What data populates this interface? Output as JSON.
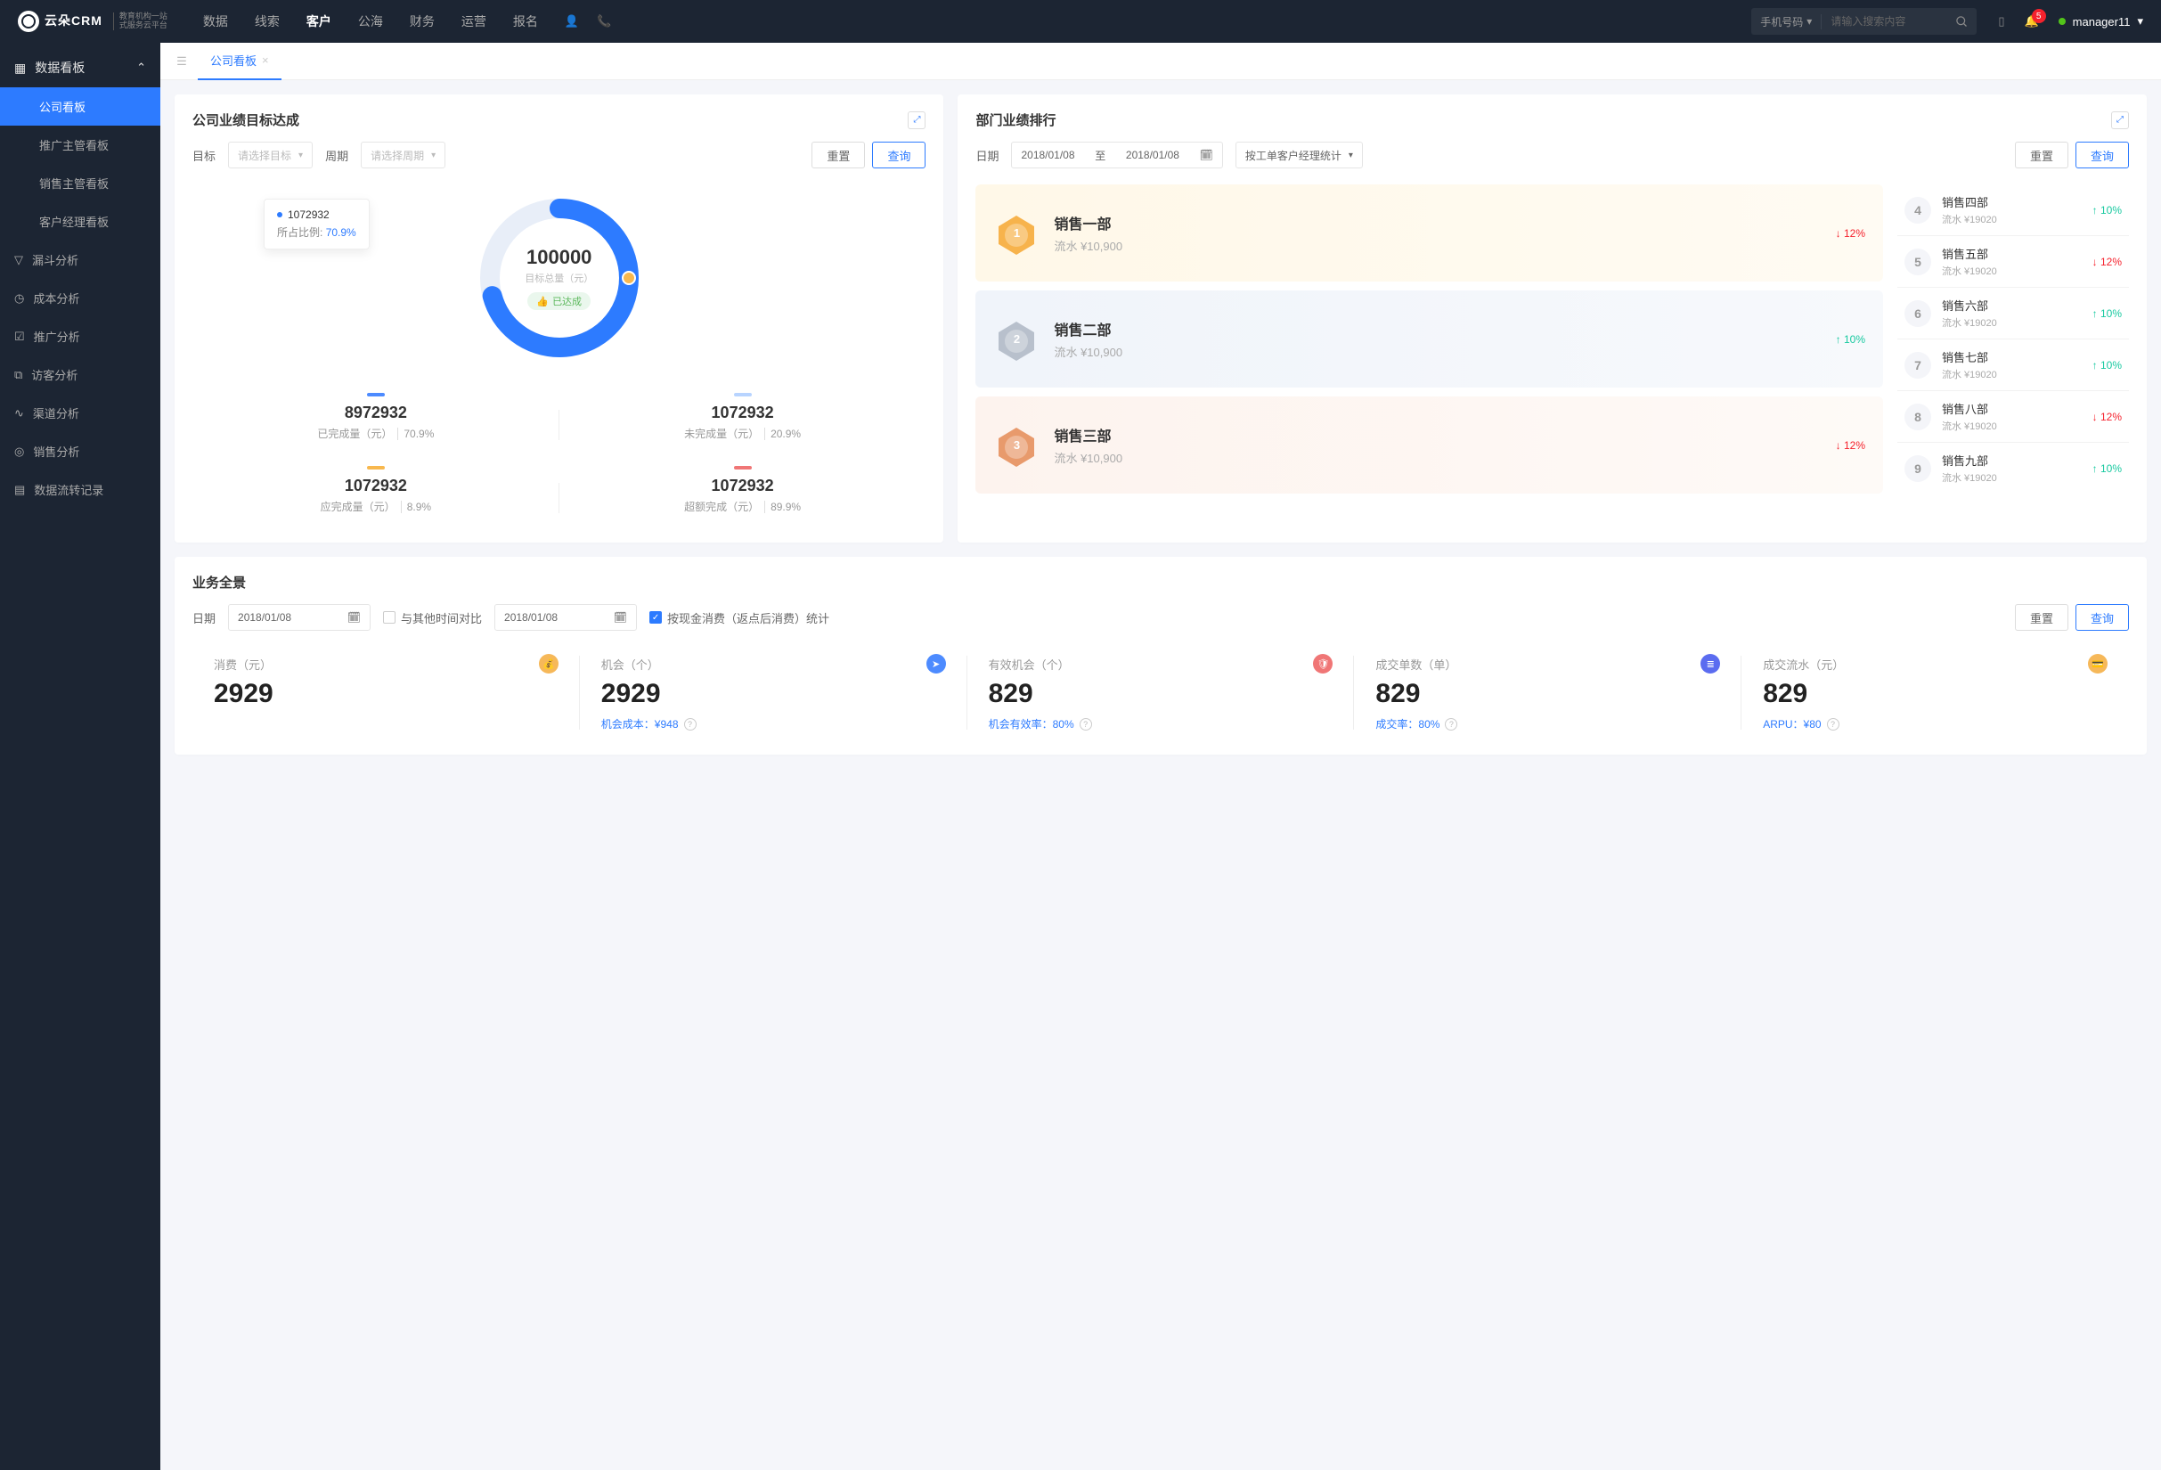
{
  "brand": {
    "name": "云朵CRM",
    "sub1": "教育机构一站",
    "sub2": "式服务云平台"
  },
  "nav": {
    "items": [
      "数据",
      "线索",
      "客户",
      "公海",
      "财务",
      "运营",
      "报名"
    ],
    "active": 2
  },
  "search": {
    "type": "手机号码",
    "placeholder": "请输入搜索内容"
  },
  "notif": {
    "count": "5"
  },
  "user": {
    "name": "manager11"
  },
  "sidebar": {
    "group": "数据看板",
    "items": [
      "公司看板",
      "推广主管看板",
      "销售主管看板",
      "客户经理看板"
    ],
    "active": 0,
    "cats": [
      "漏斗分析",
      "成本分析",
      "推广分析",
      "访客分析",
      "渠道分析",
      "销售分析",
      "数据流转记录"
    ]
  },
  "tab": {
    "name": "公司看板"
  },
  "goal": {
    "title": "公司业绩目标达成",
    "labels": {
      "target": "目标",
      "period": "周期"
    },
    "placeholders": {
      "target": "请选择目标",
      "period": "请选择周期"
    },
    "buttons": {
      "reset": "重置",
      "query": "查询"
    },
    "tooltip": {
      "value": "1072932",
      "ratioLabel": "所占比例:",
      "ratio": "70.9%"
    },
    "center": {
      "value": "100000",
      "sub": "目标总量（元）",
      "badge": "已达成"
    },
    "stats": [
      {
        "bar": "#4d8bff",
        "value": "8972932",
        "label": "已完成量（元）",
        "pct": "70.9%"
      },
      {
        "bar": "#b8d4ff",
        "value": "1072932",
        "label": "未完成量（元）",
        "pct": "20.9%"
      },
      {
        "bar": "#f8b84e",
        "value": "1072932",
        "label": "应完成量（元）",
        "pct": "8.9%"
      },
      {
        "bar": "#f07676",
        "value": "1072932",
        "label": "超额完成（元）",
        "pct": "89.9%"
      }
    ]
  },
  "rank": {
    "title": "部门业绩排行",
    "labels": {
      "date": "日期",
      "to": "至"
    },
    "date1": "2018/01/08",
    "date2": "2018/01/08",
    "grouping": "按工单客户经理统计",
    "buttons": {
      "reset": "重置",
      "query": "查询"
    },
    "top": [
      {
        "n": "1",
        "name": "销售一部",
        "amt": "流水 ¥10,900",
        "pct": "12%",
        "dir": "down"
      },
      {
        "n": "2",
        "name": "销售二部",
        "amt": "流水 ¥10,900",
        "pct": "10%",
        "dir": "up"
      },
      {
        "n": "3",
        "name": "销售三部",
        "amt": "流水 ¥10,900",
        "pct": "12%",
        "dir": "down"
      }
    ],
    "list": [
      {
        "n": "4",
        "name": "销售四部",
        "amt": "流水 ¥19020",
        "pct": "10%",
        "dir": "up"
      },
      {
        "n": "5",
        "name": "销售五部",
        "amt": "流水 ¥19020",
        "pct": "12%",
        "dir": "down"
      },
      {
        "n": "6",
        "name": "销售六部",
        "amt": "流水 ¥19020",
        "pct": "10%",
        "dir": "up"
      },
      {
        "n": "7",
        "name": "销售七部",
        "amt": "流水 ¥19020",
        "pct": "10%",
        "dir": "up"
      },
      {
        "n": "8",
        "name": "销售八部",
        "amt": "流水 ¥19020",
        "pct": "12%",
        "dir": "down"
      },
      {
        "n": "9",
        "name": "销售九部",
        "amt": "流水 ¥19020",
        "pct": "10%",
        "dir": "up"
      }
    ]
  },
  "overview": {
    "title": "业务全景",
    "labels": {
      "date": "日期",
      "compare": "与其他时间对比",
      "checkbox": "按现金消费（返点后消费）统计"
    },
    "date1": "2018/01/08",
    "date2": "2018/01/08",
    "buttons": {
      "reset": "重置",
      "query": "查询"
    },
    "kpis": [
      {
        "label": "消费（元）",
        "value": "2929",
        "foot": "",
        "icon": "#f6b859"
      },
      {
        "label": "机会（个）",
        "value": "2929",
        "foot": "机会成本：¥948",
        "icon": "#4d8bff"
      },
      {
        "label": "有效机会（个）",
        "value": "829",
        "foot": "机会有效率：80%",
        "icon": "#f07676"
      },
      {
        "label": "成交单数（单）",
        "value": "829",
        "foot": "成交率：80%",
        "icon": "#5b6cf0"
      },
      {
        "label": "成交流水（元）",
        "value": "829",
        "foot": "ARPU：¥80",
        "icon": "#f6b859"
      }
    ]
  },
  "chart_data": {
    "type": "pie",
    "title": "目标总量（元）",
    "total": 100000,
    "series": [
      {
        "name": "已完成量",
        "value": 8972932,
        "pct": 70.9,
        "color": "#2d7bff"
      },
      {
        "name": "未完成量",
        "value": 1072932,
        "pct": 20.9,
        "color": "#b8d4ff"
      },
      {
        "name": "应完成量",
        "value": 1072932,
        "pct": 8.9,
        "color": "#f8b84e"
      },
      {
        "name": "超额完成",
        "value": 1072932,
        "pct": 89.9,
        "color": "#f07676"
      }
    ]
  }
}
